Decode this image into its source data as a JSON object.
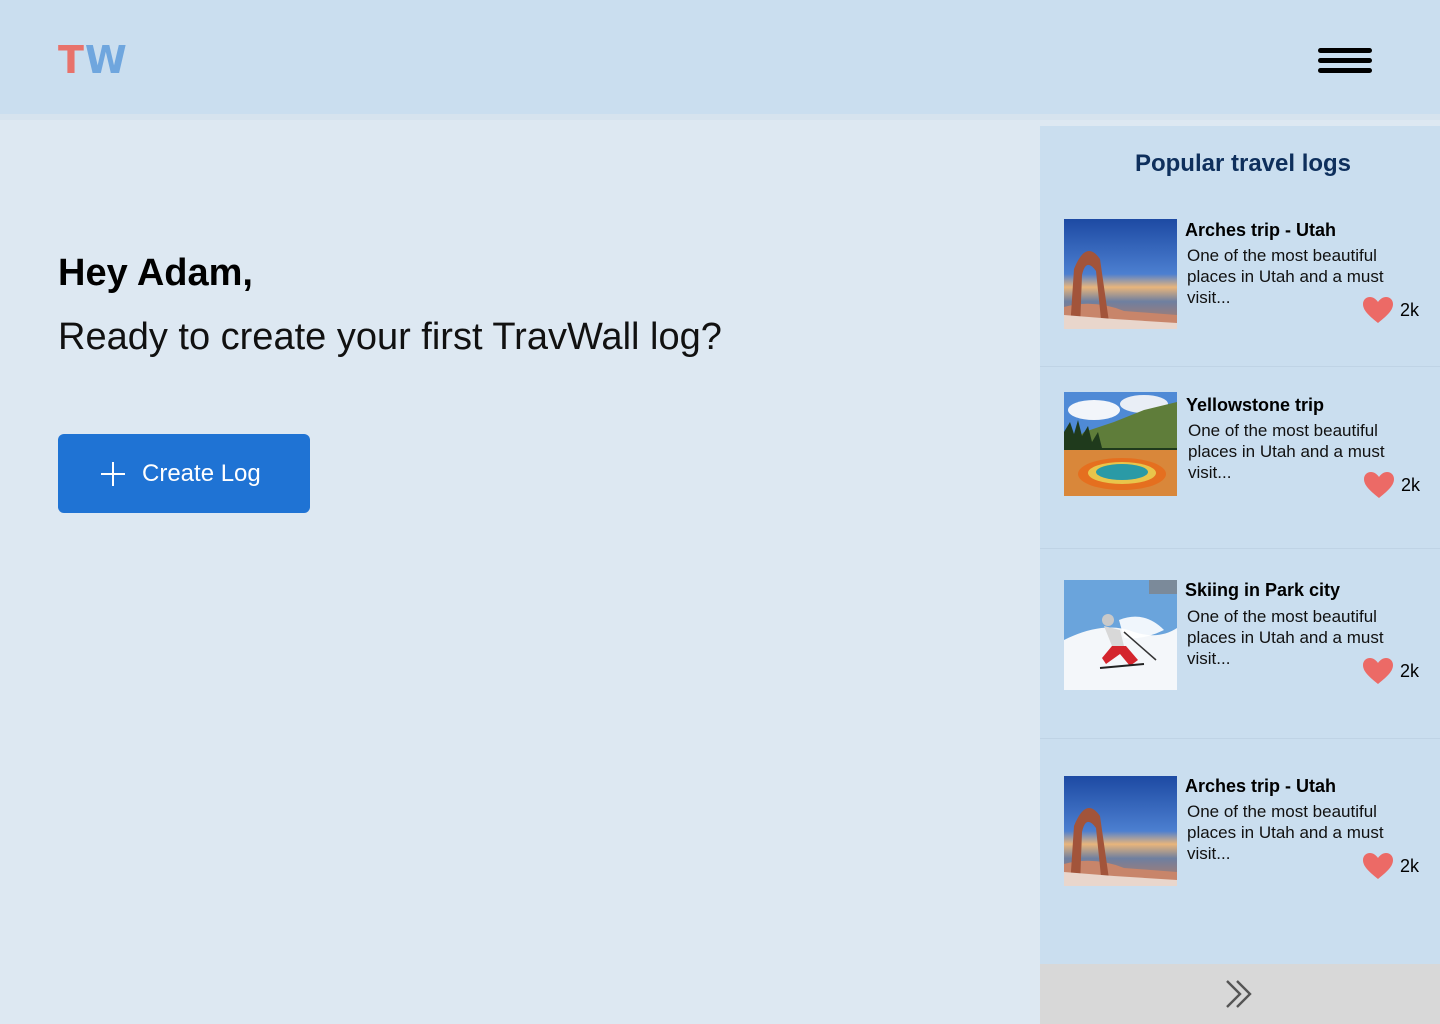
{
  "header": {
    "logo_t": "T",
    "logo_w": "W",
    "menu_icon": "hamburger-menu-icon"
  },
  "main": {
    "greeting": "Hey Adam,",
    "subtitle": "Ready to create your first TravWall log?",
    "create_button": "Create Log",
    "create_icon": "plus-icon"
  },
  "sidebar": {
    "title": "Popular travel logs",
    "logs": [
      {
        "title": "Arches trip - Utah",
        "description": "One of the most beautiful places in Utah and a must visit...",
        "likes": "2k",
        "image": "arches"
      },
      {
        "title": "Yellowstone trip",
        "description": "One of the most beautiful places in Utah and a must visit...",
        "likes": "2k",
        "image": "yellowstone"
      },
      {
        "title": "Skiing in Park city",
        "description": "One of the most beautiful places in Utah and a must visit...",
        "likes": "2k",
        "image": "skiing"
      },
      {
        "title": "Arches trip - Utah",
        "description": "One of the most beautiful places in Utah and a must visit...",
        "likes": "2k",
        "image": "arches"
      }
    ],
    "more_icon": "double-chevron-right-icon"
  },
  "colors": {
    "accent": "#1f73d4",
    "logo_t": "#e8726b",
    "logo_w": "#6fa6de",
    "heart": "#ec6a66",
    "sidebar_title": "#0e2f5c"
  }
}
